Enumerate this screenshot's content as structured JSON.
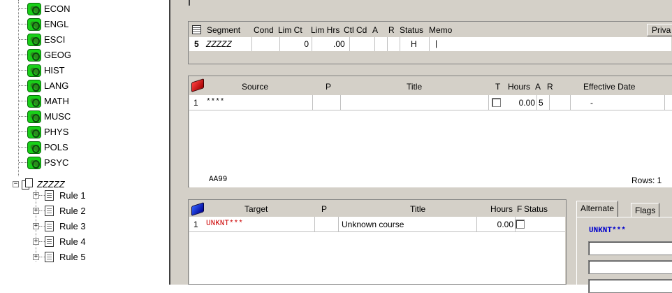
{
  "tree": {
    "items": [
      {
        "label": "ECON",
        "icon": "gear-network-icon"
      },
      {
        "label": "ENGL",
        "icon": "gear-network-icon"
      },
      {
        "label": "ESCI",
        "icon": "gear-network-icon"
      },
      {
        "label": "GEOG",
        "icon": "gear-network-icon"
      },
      {
        "label": "HIST",
        "icon": "gear-network-icon"
      },
      {
        "label": "LANG",
        "icon": "gear-network-icon"
      },
      {
        "label": "MATH",
        "icon": "gear-network-icon"
      },
      {
        "label": "MUSC",
        "icon": "gear-network-icon"
      },
      {
        "label": "PHYS",
        "icon": "gear-network-icon"
      },
      {
        "label": "POLS",
        "icon": "gear-network-icon"
      },
      {
        "label": "PSYC",
        "icon": "gear-network-icon"
      }
    ],
    "expanded_node": {
      "label": "ZZZZZ",
      "toggle": "−"
    },
    "rules": [
      {
        "label": "Rule 1",
        "toggle": "+"
      },
      {
        "label": "Rule 2",
        "toggle": "+"
      },
      {
        "label": "Rule 3",
        "toggle": "+"
      },
      {
        "label": "Rule 4",
        "toggle": "+"
      },
      {
        "label": "Rule 5",
        "toggle": "+"
      }
    ]
  },
  "segment": {
    "headers": [
      "Segment",
      "Cond",
      "Lim Ct",
      "Lim Hrs",
      "Ctl Cd",
      "A",
      "R",
      "Status",
      "Memo"
    ],
    "row_number": "5",
    "segment_value": "ZZZZZ",
    "lim_ct": "0",
    "lim_hrs": ".00",
    "status": "H",
    "memo": "|",
    "private_button": "Priva"
  },
  "source": {
    "headers": [
      "Source",
      "P",
      "Title",
      "T",
      "Hours",
      "A",
      "R",
      "Effective Date"
    ],
    "row_number": "1",
    "source_value": "****",
    "hours": "0.00",
    "a_value": "5",
    "effective_date": "-",
    "footer_code": "AA99",
    "rows_label": "Rows: 1"
  },
  "target": {
    "headers": [
      "Target",
      "P",
      "Title",
      "Hours",
      "F",
      "Status"
    ],
    "row_number": "1",
    "target_value": "UNKNT***",
    "title": "Unknown course",
    "hours": "0.00"
  },
  "tabs": {
    "alternate": "Alternate",
    "flags": "Flags",
    "alternate_value": "UNKNT***"
  },
  "colors": {
    "target_text": "#cc0000",
    "alternate_text": "#0000cc",
    "tree_icon": "#18d018",
    "panel_bg": "#d4d0c8"
  }
}
